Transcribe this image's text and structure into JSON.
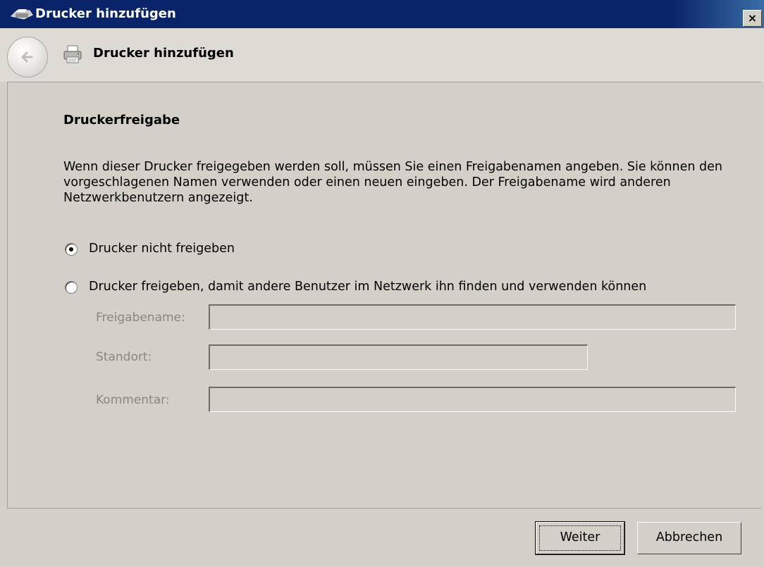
{
  "window": {
    "title": "Drucker hinzufügen",
    "close_glyph": "×",
    "title_icon": "printer-add-icon"
  },
  "nav": {
    "back_icon": "back-arrow-icon",
    "printer_icon": "printer-icon",
    "title": "Drucker hinzufügen"
  },
  "page": {
    "heading": "Druckerfreigabe",
    "description": "Wenn dieser Drucker freigegeben werden soll, müssen Sie einen Freigabenamen angeben. Sie können den vorgeschlagenen Namen verwenden oder einen neuen eingeben. Der Freigabename wird anderen Netzwerkbenutzern angezeigt.",
    "options": [
      {
        "label": "Drucker nicht freigeben",
        "selected": true
      },
      {
        "label": "Drucker freigeben, damit andere Benutzer im Netzwerk ihn finden und verwenden können",
        "selected": false
      }
    ],
    "fields": {
      "share_name": {
        "label": "Freigabename:",
        "value": "",
        "disabled": true
      },
      "location": {
        "label": "Standort:",
        "value": "",
        "disabled": true
      },
      "comment": {
        "label": "Kommentar:",
        "value": "",
        "disabled": true
      }
    }
  },
  "footer": {
    "next_label": "Weiter",
    "cancel_label": "Abbrechen"
  },
  "colors": {
    "titlebar": "#0a246a",
    "dialog_bg": "#d4d0c8",
    "disabled_text": "#8a8780"
  }
}
